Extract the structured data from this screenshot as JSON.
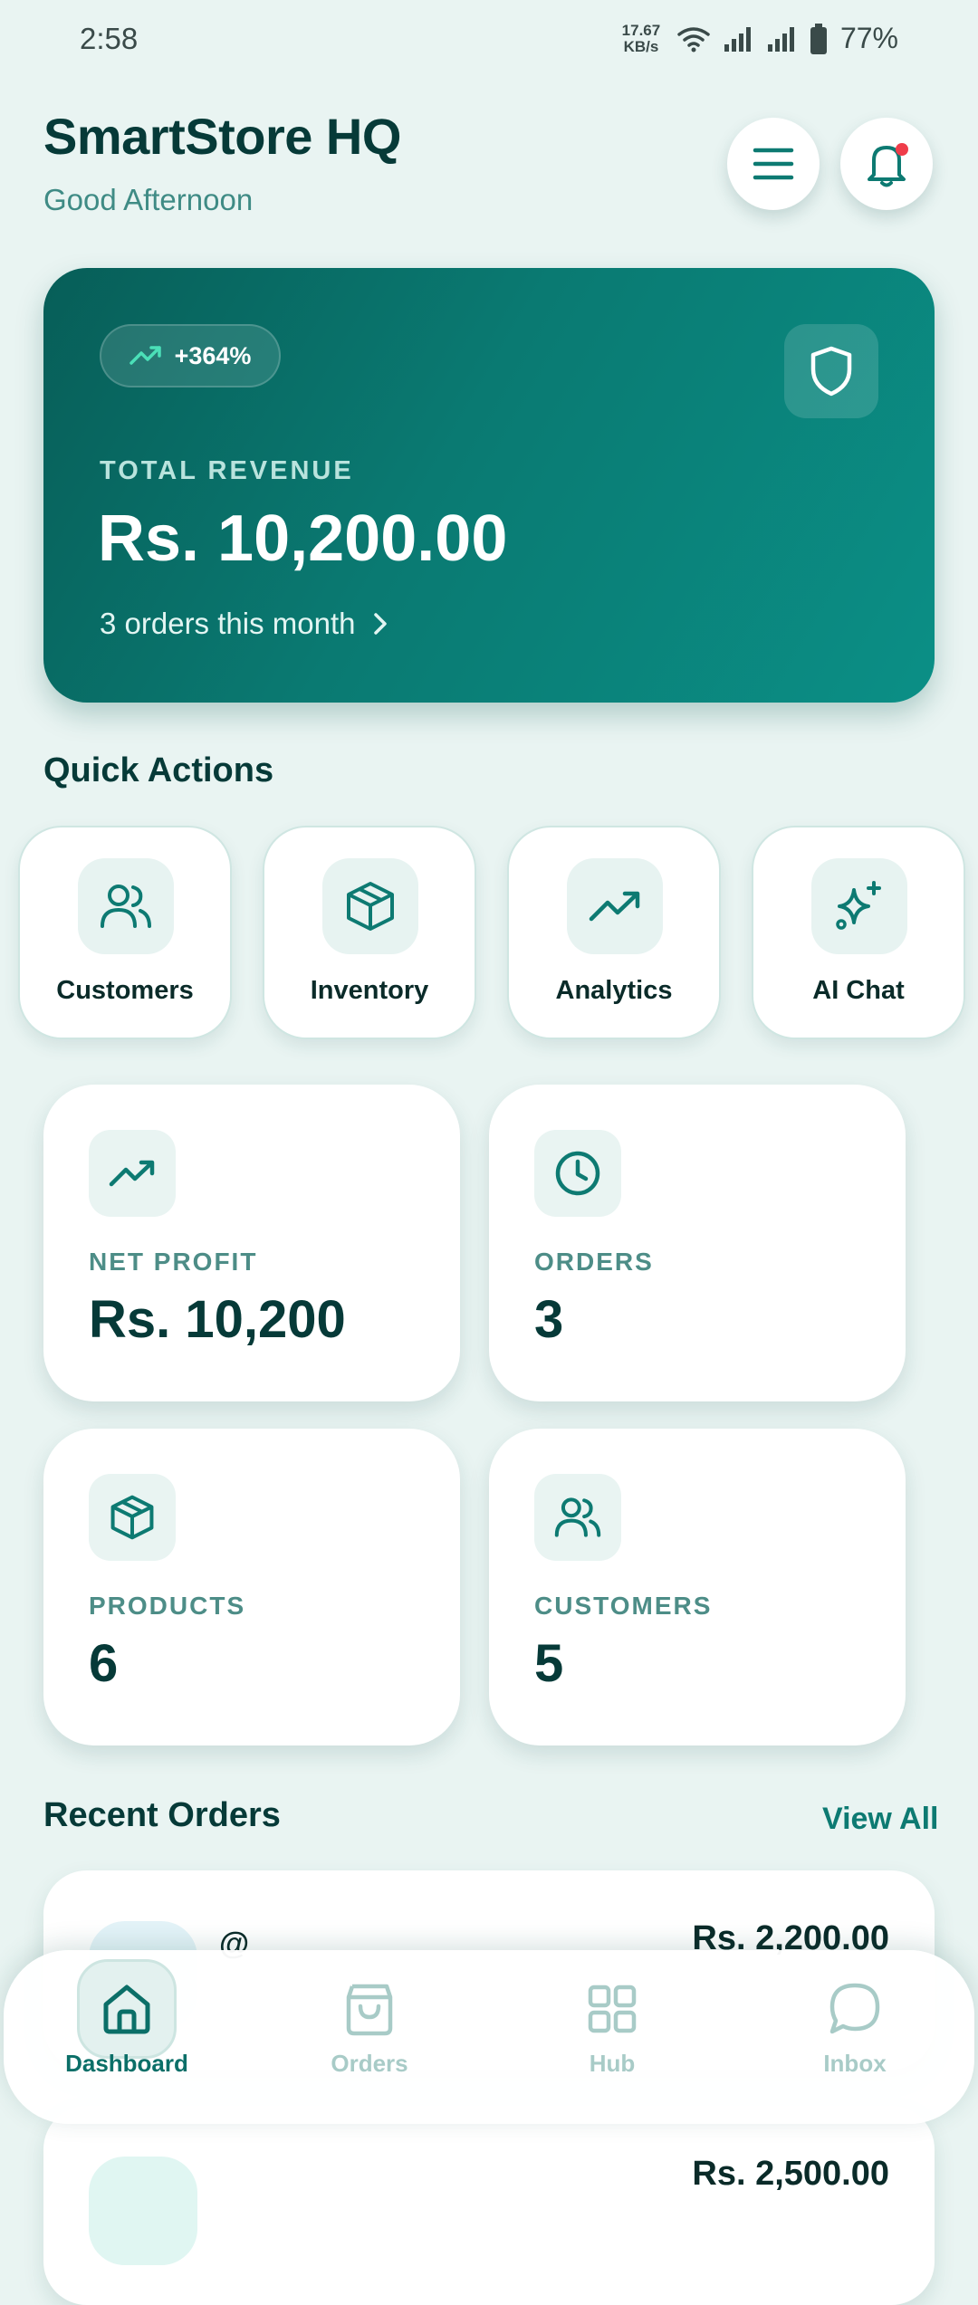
{
  "status_bar": {
    "time": "2:58",
    "net_speed_value": "17.67",
    "net_speed_unit": "KB/s",
    "battery": "77%"
  },
  "header": {
    "title": "SmartStore HQ",
    "greeting": "Good Afternoon",
    "notification_dot_color": "#ef3d4a"
  },
  "revenue": {
    "growth": "+364%",
    "label": "TOTAL REVENUE",
    "amount": "Rs. 10,200.00",
    "orders_summary": "3 orders this month"
  },
  "quick_actions": {
    "title": "Quick Actions",
    "items": [
      {
        "label": "Customers",
        "icon": "users-icon"
      },
      {
        "label": "Inventory",
        "icon": "box-icon"
      },
      {
        "label": "Analytics",
        "icon": "trending-up-icon"
      },
      {
        "label": "AI Chat",
        "icon": "sparkles-icon"
      }
    ]
  },
  "stats": [
    {
      "label": "NET PROFIT",
      "value": "Rs. 10,200",
      "icon": "trending-up-icon"
    },
    {
      "label": "ORDERS",
      "value": "3",
      "icon": "clock-icon"
    },
    {
      "label": "PRODUCTS",
      "value": "6",
      "icon": "box-icon"
    },
    {
      "label": "CUSTOMERS",
      "value": "5",
      "icon": "users-icon"
    }
  ],
  "recent_orders": {
    "title": "Recent Orders",
    "view_all": "View All",
    "orders": [
      {
        "name": "@",
        "amount": "Rs. 2,200.00"
      },
      {
        "name": "",
        "amount": "Rs. 2,500.00"
      }
    ]
  },
  "bottom_nav": {
    "items": [
      {
        "label": "Dashboard",
        "icon": "home-icon",
        "active": true
      },
      {
        "label": "Orders",
        "icon": "shopping-bag-icon",
        "active": false
      },
      {
        "label": "Hub",
        "icon": "grid-icon",
        "active": false
      },
      {
        "label": "Inbox",
        "icon": "chat-bubble-icon",
        "active": false
      }
    ]
  },
  "colors": {
    "accent": "#0d7a72",
    "background": "#e9f4f2",
    "card": "#ffffff",
    "text_dark": "#063a38"
  }
}
